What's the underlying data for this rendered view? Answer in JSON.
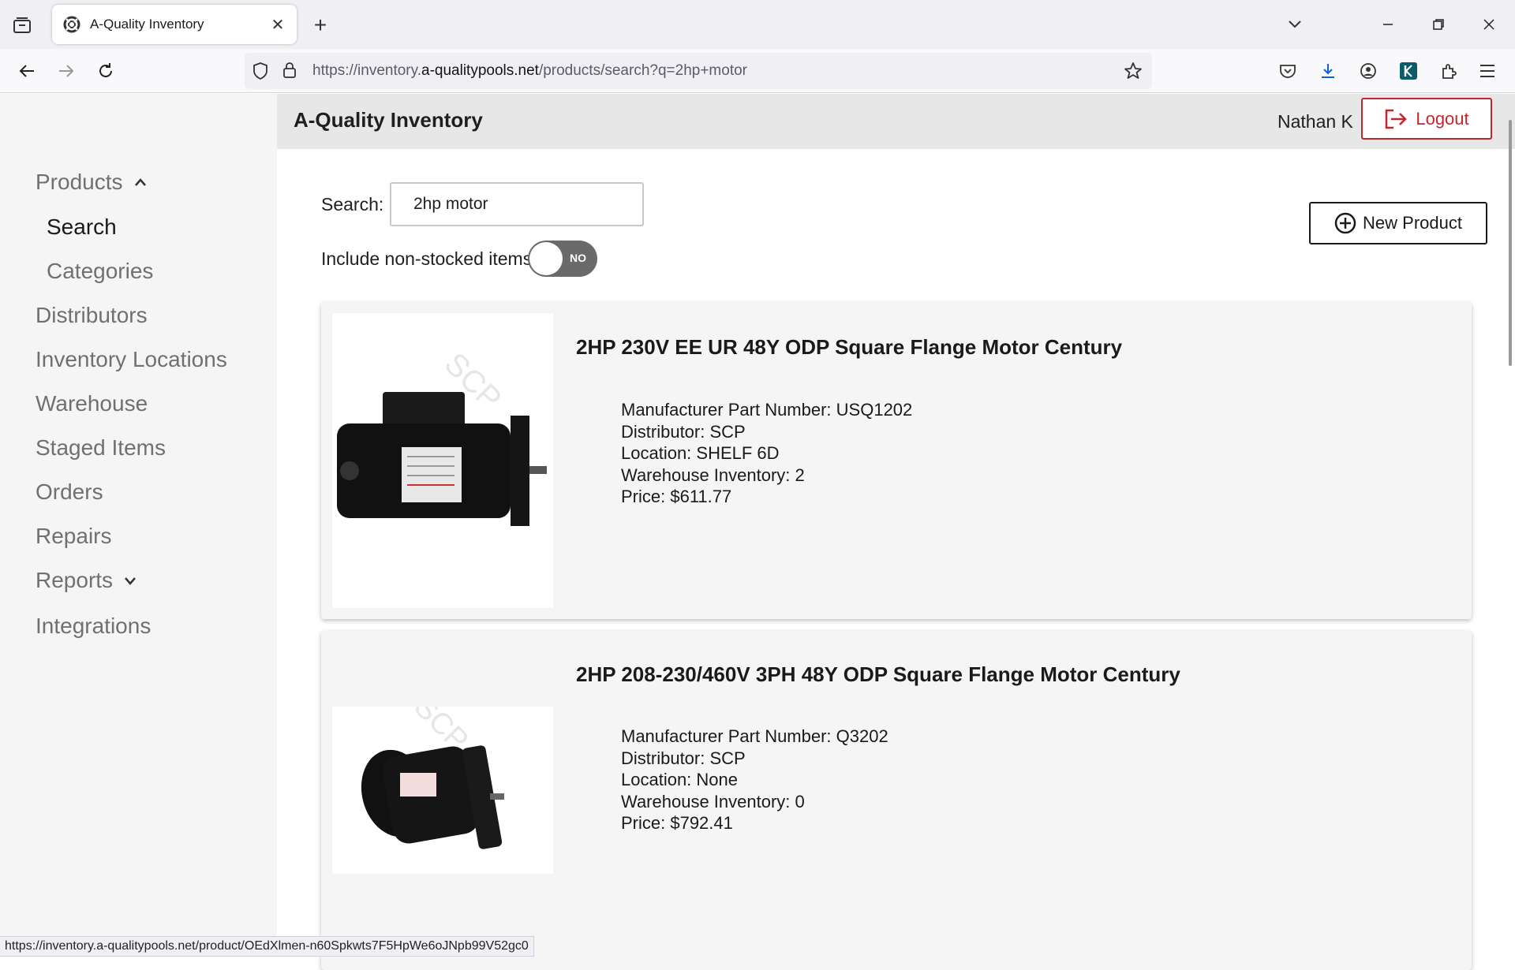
{
  "browser": {
    "tab_title": "A-Quality Inventory",
    "url_prefix": "https://inventory.",
    "url_domain": "a-qualitypools.net",
    "url_path": "/products/search?q=2hp+motor",
    "status_url": "https://inventory.a-qualitypools.net/product/OEdXlmen-n60Spkwts7F5HpWe6oJNpb99V52gc0"
  },
  "header": {
    "app_title": "A-Quality Inventory",
    "user_name": "Nathan K",
    "logout_label": "Logout"
  },
  "sidebar": {
    "items": [
      {
        "label": "Products"
      },
      {
        "label": "Search"
      },
      {
        "label": "Categories"
      },
      {
        "label": "Distributors"
      },
      {
        "label": "Inventory Locations"
      },
      {
        "label": "Warehouse"
      },
      {
        "label": "Staged Items"
      },
      {
        "label": "Orders"
      },
      {
        "label": "Repairs"
      },
      {
        "label": "Reports"
      },
      {
        "label": "Integrations"
      }
    ]
  },
  "search": {
    "label": "Search:",
    "value": "2hp motor",
    "toggle_label": "Include non-stocked items",
    "toggle_state": "NO",
    "new_product_label": "New Product"
  },
  "products": [
    {
      "title": "2HP 230V EE UR 48Y ODP Square Flange Motor Century",
      "part": "Manufacturer Part Number: USQ1202",
      "distributor": "Distributor: SCP",
      "location": "Location: SHELF 6D",
      "inventory": "Warehouse Inventory: 2",
      "price": "Price: $611.77"
    },
    {
      "title": "2HP 208-230/460V 3PH 48Y ODP Square Flange Motor Century",
      "part": "Manufacturer Part Number: Q3202",
      "distributor": "Distributor: SCP",
      "location": "Location: None",
      "inventory": "Warehouse Inventory: 0",
      "price": "Price: $792.41"
    }
  ],
  "colors": {
    "accent_red": "#c0272d",
    "sidebar_bg": "#f5f5f5",
    "header_bg": "#e7e7e7"
  }
}
